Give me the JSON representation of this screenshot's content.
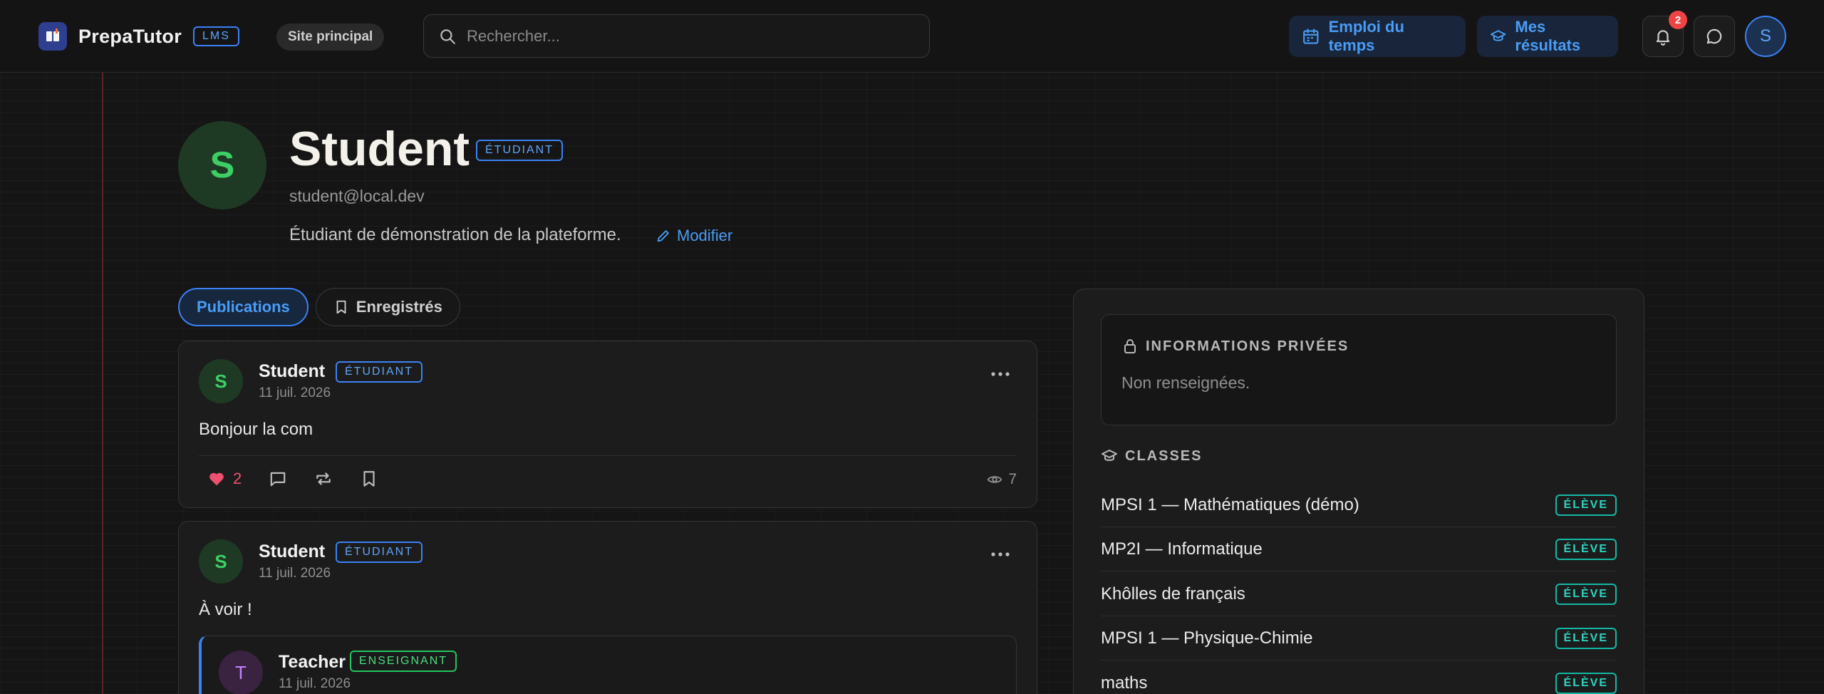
{
  "header": {
    "brand_name": "PrepaTutor",
    "brand_badge": "LMS",
    "site_pill": "Site principal",
    "search_placeholder": "Rechercher...",
    "schedule_button": "Emploi du temps",
    "results_button": "Mes résultats",
    "notifications_count": "2",
    "user_initial": "S"
  },
  "profile": {
    "initial": "S",
    "name": "Student",
    "role": "ÉTUDIANT",
    "email": "student@local.dev",
    "bio": "Étudiant de démonstration de la plateforme.",
    "edit_label": "Modifier"
  },
  "tabs": [
    {
      "label": "Publications",
      "active": true
    },
    {
      "label": "Enregistrés",
      "active": false
    }
  ],
  "posts": [
    {
      "initial": "S",
      "author": "Student",
      "role": "ÉTUDIANT",
      "date": "11 juil. 2026",
      "text": "Bonjour la com",
      "likes": "2",
      "views": "7"
    },
    {
      "initial": "S",
      "author": "Student",
      "role": "ÉTUDIANT",
      "date": "11 juil. 2026",
      "text": "À voir !",
      "quoted": {
        "initial": "T",
        "author": "Teacher",
        "role": "ENSEIGNANT",
        "date": "11 juil. 2026"
      }
    }
  ],
  "sidebar": {
    "private_title": "INFORMATIONS PRIVÉES",
    "private_text": "Non renseignées.",
    "classes_title": "CLASSES",
    "classes": [
      {
        "name": "MPSI 1 — Mathématiques (démo)",
        "badge": "ÉLÈVE"
      },
      {
        "name": "MP2I — Informatique",
        "badge": "ÉLÈVE"
      },
      {
        "name": "Khôlles de français",
        "badge": "ÉLÈVE"
      },
      {
        "name": "MPSI 1 — Physique-Chimie",
        "badge": "ÉLÈVE"
      },
      {
        "name": "maths",
        "badge": "ÉLÈVE"
      }
    ]
  },
  "colors": {
    "accent_blue": "#3b82f6",
    "like_pink": "#f0506e",
    "teacher_green": "#22c55e",
    "class_teal": "#14b8a6",
    "margin_red": "#5a2525"
  }
}
